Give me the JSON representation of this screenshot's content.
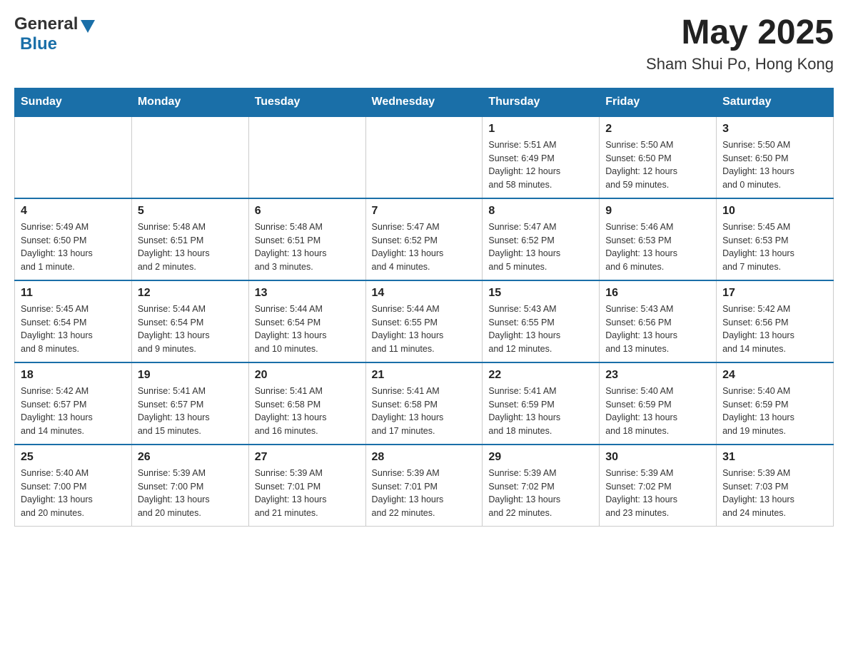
{
  "header": {
    "logo_general": "General",
    "logo_blue": "Blue",
    "month_year": "May 2025",
    "location": "Sham Shui Po, Hong Kong"
  },
  "weekdays": [
    "Sunday",
    "Monday",
    "Tuesday",
    "Wednesday",
    "Thursday",
    "Friday",
    "Saturday"
  ],
  "weeks": [
    {
      "days": [
        {
          "number": "",
          "info": ""
        },
        {
          "number": "",
          "info": ""
        },
        {
          "number": "",
          "info": ""
        },
        {
          "number": "",
          "info": ""
        },
        {
          "number": "1",
          "info": "Sunrise: 5:51 AM\nSunset: 6:49 PM\nDaylight: 12 hours\nand 58 minutes."
        },
        {
          "number": "2",
          "info": "Sunrise: 5:50 AM\nSunset: 6:50 PM\nDaylight: 12 hours\nand 59 minutes."
        },
        {
          "number": "3",
          "info": "Sunrise: 5:50 AM\nSunset: 6:50 PM\nDaylight: 13 hours\nand 0 minutes."
        }
      ]
    },
    {
      "days": [
        {
          "number": "4",
          "info": "Sunrise: 5:49 AM\nSunset: 6:50 PM\nDaylight: 13 hours\nand 1 minute."
        },
        {
          "number": "5",
          "info": "Sunrise: 5:48 AM\nSunset: 6:51 PM\nDaylight: 13 hours\nand 2 minutes."
        },
        {
          "number": "6",
          "info": "Sunrise: 5:48 AM\nSunset: 6:51 PM\nDaylight: 13 hours\nand 3 minutes."
        },
        {
          "number": "7",
          "info": "Sunrise: 5:47 AM\nSunset: 6:52 PM\nDaylight: 13 hours\nand 4 minutes."
        },
        {
          "number": "8",
          "info": "Sunrise: 5:47 AM\nSunset: 6:52 PM\nDaylight: 13 hours\nand 5 minutes."
        },
        {
          "number": "9",
          "info": "Sunrise: 5:46 AM\nSunset: 6:53 PM\nDaylight: 13 hours\nand 6 minutes."
        },
        {
          "number": "10",
          "info": "Sunrise: 5:45 AM\nSunset: 6:53 PM\nDaylight: 13 hours\nand 7 minutes."
        }
      ]
    },
    {
      "days": [
        {
          "number": "11",
          "info": "Sunrise: 5:45 AM\nSunset: 6:54 PM\nDaylight: 13 hours\nand 8 minutes."
        },
        {
          "number": "12",
          "info": "Sunrise: 5:44 AM\nSunset: 6:54 PM\nDaylight: 13 hours\nand 9 minutes."
        },
        {
          "number": "13",
          "info": "Sunrise: 5:44 AM\nSunset: 6:54 PM\nDaylight: 13 hours\nand 10 minutes."
        },
        {
          "number": "14",
          "info": "Sunrise: 5:44 AM\nSunset: 6:55 PM\nDaylight: 13 hours\nand 11 minutes."
        },
        {
          "number": "15",
          "info": "Sunrise: 5:43 AM\nSunset: 6:55 PM\nDaylight: 13 hours\nand 12 minutes."
        },
        {
          "number": "16",
          "info": "Sunrise: 5:43 AM\nSunset: 6:56 PM\nDaylight: 13 hours\nand 13 minutes."
        },
        {
          "number": "17",
          "info": "Sunrise: 5:42 AM\nSunset: 6:56 PM\nDaylight: 13 hours\nand 14 minutes."
        }
      ]
    },
    {
      "days": [
        {
          "number": "18",
          "info": "Sunrise: 5:42 AM\nSunset: 6:57 PM\nDaylight: 13 hours\nand 14 minutes."
        },
        {
          "number": "19",
          "info": "Sunrise: 5:41 AM\nSunset: 6:57 PM\nDaylight: 13 hours\nand 15 minutes."
        },
        {
          "number": "20",
          "info": "Sunrise: 5:41 AM\nSunset: 6:58 PM\nDaylight: 13 hours\nand 16 minutes."
        },
        {
          "number": "21",
          "info": "Sunrise: 5:41 AM\nSunset: 6:58 PM\nDaylight: 13 hours\nand 17 minutes."
        },
        {
          "number": "22",
          "info": "Sunrise: 5:41 AM\nSunset: 6:59 PM\nDaylight: 13 hours\nand 18 minutes."
        },
        {
          "number": "23",
          "info": "Sunrise: 5:40 AM\nSunset: 6:59 PM\nDaylight: 13 hours\nand 18 minutes."
        },
        {
          "number": "24",
          "info": "Sunrise: 5:40 AM\nSunset: 6:59 PM\nDaylight: 13 hours\nand 19 minutes."
        }
      ]
    },
    {
      "days": [
        {
          "number": "25",
          "info": "Sunrise: 5:40 AM\nSunset: 7:00 PM\nDaylight: 13 hours\nand 20 minutes."
        },
        {
          "number": "26",
          "info": "Sunrise: 5:39 AM\nSunset: 7:00 PM\nDaylight: 13 hours\nand 20 minutes."
        },
        {
          "number": "27",
          "info": "Sunrise: 5:39 AM\nSunset: 7:01 PM\nDaylight: 13 hours\nand 21 minutes."
        },
        {
          "number": "28",
          "info": "Sunrise: 5:39 AM\nSunset: 7:01 PM\nDaylight: 13 hours\nand 22 minutes."
        },
        {
          "number": "29",
          "info": "Sunrise: 5:39 AM\nSunset: 7:02 PM\nDaylight: 13 hours\nand 22 minutes."
        },
        {
          "number": "30",
          "info": "Sunrise: 5:39 AM\nSunset: 7:02 PM\nDaylight: 13 hours\nand 23 minutes."
        },
        {
          "number": "31",
          "info": "Sunrise: 5:39 AM\nSunset: 7:03 PM\nDaylight: 13 hours\nand 24 minutes."
        }
      ]
    }
  ]
}
